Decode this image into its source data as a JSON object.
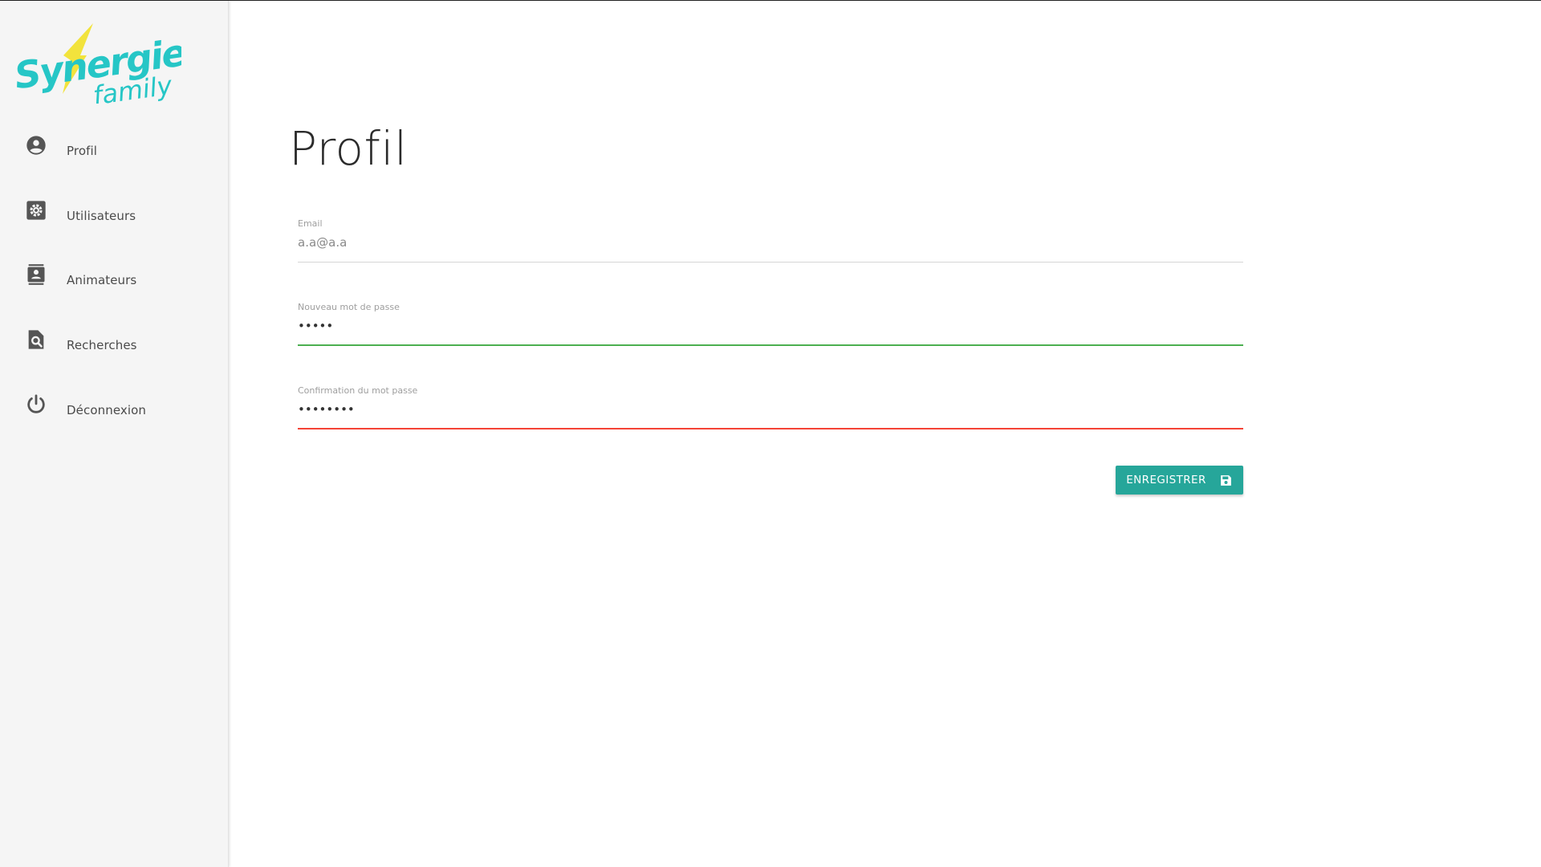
{
  "app": {
    "logo_word_1": "Synergie",
    "logo_word_2": "family",
    "brand_color": "#26c6c6",
    "bolt_color": "#f2e33c"
  },
  "sidebar": {
    "items": [
      {
        "label": "Profil",
        "icon": "account-circle-icon"
      },
      {
        "label": "Utilisateurs",
        "icon": "gear-icon"
      },
      {
        "label": "Animateurs",
        "icon": "contact-card-icon"
      },
      {
        "label": "Recherches",
        "icon": "document-search-icon"
      },
      {
        "label": "Déconnexion",
        "icon": "power-icon"
      }
    ]
  },
  "main": {
    "title": "Profil",
    "form": {
      "email": {
        "label": "Email",
        "value": "a.a@a.a",
        "state": "disabled"
      },
      "new_password": {
        "label": "Nouveau mot de passe",
        "value": "•••••",
        "state": "valid"
      },
      "confirm_password": {
        "label": "Confirmation du mot passe",
        "value": "••••••••",
        "state": "invalid"
      }
    },
    "save_button": {
      "label": "ENREGISTRER",
      "icon": "save-icon"
    }
  },
  "colors": {
    "accent": "#26a69a",
    "valid": "#4caf50",
    "invalid": "#f44336",
    "sidebar_bg": "#f5f5f5"
  }
}
